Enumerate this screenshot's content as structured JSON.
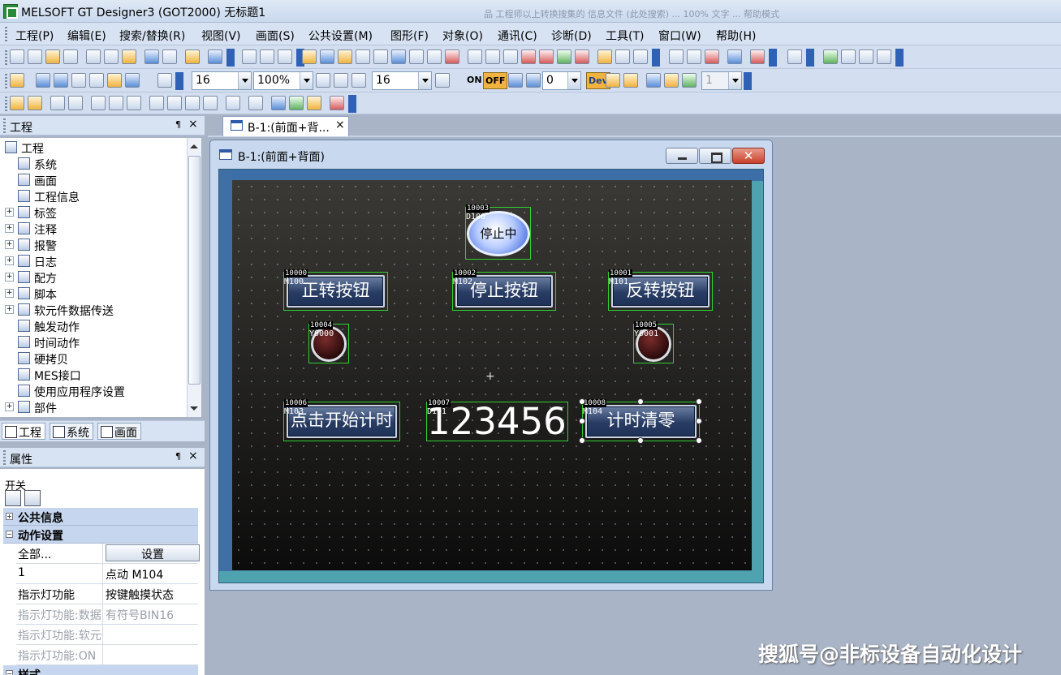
{
  "app": {
    "title": "MELSOFT GT Designer3 (GOT2000) 无标题1",
    "ghost_title": "品 工程师以上转换搜集的 信息文件 (此处搜索) ... 100% 文字 ... 帮助模式"
  },
  "menu": [
    "工程(P)",
    "编辑(E)",
    "搜索/替换(R)",
    "视图(V)",
    "画面(S)",
    "公共设置(M)",
    "图形(F)",
    "对象(O)",
    "通讯(C)",
    "诊断(D)",
    "工具(T)",
    "窗口(W)",
    "帮助(H)"
  ],
  "toolbar": {
    "font_size": "16",
    "zoom": "100%",
    "text_size": "16",
    "on_label": "ON",
    "off_label": "OFF",
    "step_value": "0",
    "dev_label": "Dev",
    "layer_value": "1"
  },
  "project_panel": {
    "title": "工程",
    "pin": "¶",
    "close": "×",
    "tree": [
      {
        "label": "工程",
        "level": 0,
        "expand": "",
        "icon": "project-icon"
      },
      {
        "label": "系统",
        "level": 1,
        "expand": "",
        "icon": "system-icon"
      },
      {
        "label": "画面",
        "level": 1,
        "expand": "",
        "icon": "screen-icon"
      },
      {
        "label": "工程信息",
        "level": 1,
        "expand": "",
        "icon": "info-icon"
      },
      {
        "label": "标签",
        "level": 1,
        "expand": "+",
        "icon": "tag-icon"
      },
      {
        "label": "注释",
        "level": 1,
        "expand": "+",
        "icon": "comment-icon"
      },
      {
        "label": "报警",
        "level": 1,
        "expand": "+",
        "icon": "alarm-icon"
      },
      {
        "label": "日志",
        "level": 1,
        "expand": "+",
        "icon": "log-icon"
      },
      {
        "label": "配方",
        "level": 1,
        "expand": "+",
        "icon": "recipe-icon"
      },
      {
        "label": "脚本",
        "level": 1,
        "expand": "+",
        "icon": "script-icon"
      },
      {
        "label": "软元件数据传送",
        "level": 1,
        "expand": "+",
        "icon": "device-transfer-icon"
      },
      {
        "label": "触发动作",
        "level": 1,
        "expand": "",
        "icon": "trigger-icon"
      },
      {
        "label": "时间动作",
        "level": 1,
        "expand": "",
        "icon": "time-action-icon"
      },
      {
        "label": "硬拷贝",
        "level": 1,
        "expand": "",
        "icon": "hardcopy-icon"
      },
      {
        "label": "MES接口",
        "level": 1,
        "expand": "",
        "icon": "mes-icon"
      },
      {
        "label": "使用应用程序设置",
        "level": 1,
        "expand": "",
        "icon": "app-settings-icon"
      },
      {
        "label": "部件",
        "level": 1,
        "expand": "+",
        "icon": "parts-icon"
      }
    ],
    "tabs": [
      "工程",
      "系统",
      "画面"
    ]
  },
  "properties_panel": {
    "title": "属性",
    "pin": "¶",
    "close": "×",
    "object_type": "开关",
    "cat_common": "公共信息",
    "cat_action": "动作设置",
    "cat_style": "样式",
    "rows": [
      {
        "key": "全部...",
        "value": "",
        "button": "设置",
        "dim": false
      },
      {
        "key": "1",
        "value": "点动 M104",
        "button": "",
        "dim": false
      },
      {
        "key": "指示灯功能",
        "value": "按键触摸状态",
        "button": "",
        "dim": false
      },
      {
        "key": "指示灯功能:数据",
        "value": "有符号BIN16",
        "button": "",
        "dim": true
      },
      {
        "key": "指示灯功能:软元件",
        "value": "",
        "button": "",
        "dim": true
      },
      {
        "key": "指示灯功能:ON",
        "value": "",
        "button": "",
        "dim": true
      }
    ]
  },
  "editor": {
    "doc_tab": "B-1:(前面+背...",
    "doc_tab_close": "×",
    "window_title": "B-1:(前面+背面)",
    "close_glyph": "✕"
  },
  "screen_objects": {
    "stop_lamp": {
      "id": "10003",
      "device": "D100",
      "label": "停止中"
    },
    "fwd_button": {
      "id": "10000",
      "device": "M100",
      "label": "正转按钮"
    },
    "stop_button": {
      "id": "10002",
      "device": "M102",
      "label": "停止按钮"
    },
    "rev_button": {
      "id": "10001",
      "device": "M101",
      "label": "反转按钮"
    },
    "lamp_y0": {
      "id": "10004",
      "device": "Y0000"
    },
    "lamp_y1": {
      "id": "10005",
      "device": "Y0001"
    },
    "start_timer_button": {
      "id": "10006",
      "device": "M103",
      "label": "点击开始计时"
    },
    "numeric_display": {
      "id": "10007",
      "device": "D101",
      "value": "123456"
    },
    "reset_timer_button": {
      "id": "10008",
      "device": "M104",
      "label": "计时清零"
    },
    "crosshair": "+"
  },
  "watermark": "搜狐号@非标设备自动化设计",
  "colors": {
    "selection": "#2fd12f",
    "canvas": "#1a1a1a",
    "button": "#283c63"
  }
}
